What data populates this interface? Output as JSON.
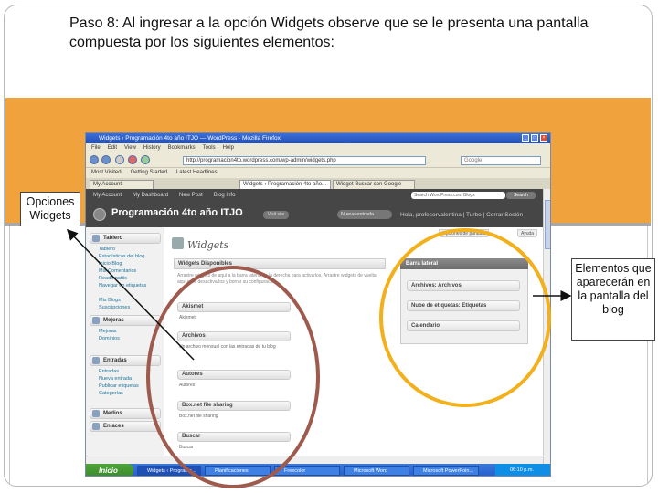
{
  "instruction": "Paso 8: Al ingresar a la opción Widgets observe que se le presenta una pantalla compuesta por los siguientes elementos:",
  "callout_left": "Opciones Widgets",
  "callout_right": "Elementos que aparecerán en la pantalla del blog",
  "browser": {
    "window_title": "Widgets ‹ Programación 4to año ITJO — WordPress - Mozilla Firefox",
    "menu": [
      "File",
      "Edit",
      "View",
      "History",
      "Bookmarks",
      "Tools",
      "Help"
    ],
    "url": "http://programacion4to.wordpress.com/wp-admin/widgets.php",
    "search_placeholder": "Google",
    "bookmarks": [
      "Most Visited",
      "Getting Started",
      "Latest Headlines"
    ],
    "tabs": [
      "My Account",
      "Widgets ‹ Programación 4to año...",
      "Widget Buscar con Google"
    ],
    "adminbar": [
      "My Account",
      "My Dashboard",
      "New Post",
      "Blog Info"
    ],
    "wp_search": "Search WordPress.com Blogs",
    "wp_search_button": "Search",
    "site_title": "Programación 4to año ITJO",
    "visit_site": "Visit site",
    "actions": "Nueva entrada",
    "howdy": "Hola, profesorvalentina | Turbo | Cerrar Sesión",
    "screen_options": "Opciones de pantalla",
    "help": "Ayuda",
    "sidebar_menu": [
      {
        "label": "Tablero",
        "items": [
          "Tablero",
          "Estadísticas del blog",
          "Inicio Blog",
          "Mis Comentarios",
          "Readomattic",
          "Navegar en etiquetas",
          "Mis Blogs",
          "Suscripciones"
        ]
      },
      {
        "label": "Mejoras",
        "items": [
          "Mejoras",
          "Dominios"
        ]
      },
      {
        "label": "Entradas",
        "items": [
          "Entradas",
          "Nueva entrada",
          "Publicar etiquetas",
          "Categorías"
        ]
      },
      {
        "label": "Medios",
        "items": []
      },
      {
        "label": "Enlaces",
        "items": []
      }
    ],
    "page_title": "Widgets",
    "available_title": "Widgets Disponibles",
    "available_desc": "Arrastre widgets de aquí a la barra lateral de la derecha para activarlos. Arrastre widgets de vuelta aquí para desactivarlos y borrar su configuración.",
    "widgets": [
      {
        "name": "Akismet",
        "desc": "Akismet"
      },
      {
        "name": "Archivos",
        "desc": "Un archivo mensual con las entradas de tu blog"
      },
      {
        "name": "Autores",
        "desc": "Autores"
      },
      {
        "name": "Box.net file sharing",
        "desc": "Box.net file sharing"
      },
      {
        "name": "Buscar",
        "desc": "Buscar"
      }
    ],
    "sidebar_title": "Barra lateral",
    "sidebar_widgets": [
      "Archivos: Archivos",
      "Nube de etiquetas: Etiquetas",
      "Calendario"
    ],
    "taskbar": {
      "start": "Inicio",
      "tasks": [
        "Widgets ‹ Programa...",
        "Planificaciones",
        "Freecolor",
        "Microsoft Word",
        "Microsoft PowerPoin..."
      ],
      "clock": "06:10 p.m."
    }
  }
}
